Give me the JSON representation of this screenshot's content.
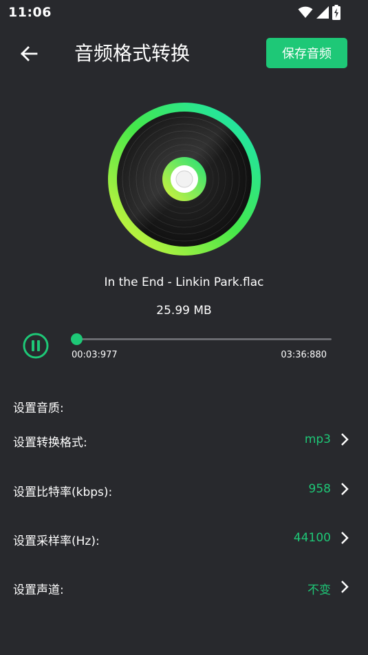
{
  "status_bar": {
    "time": "11:06",
    "icons": [
      "wifi-icon",
      "signal-icon",
      "battery-charging-icon"
    ]
  },
  "header": {
    "back_icon": "arrow-left-icon",
    "title": "音频格式转换",
    "save_label": "保存音频"
  },
  "player": {
    "file_name": "In the End - Linkin Park.flac",
    "file_size": "25.99 MB",
    "state_icon": "pause-icon",
    "current_time": "00:03:977",
    "total_time": "03:36:880",
    "progress": 0.018
  },
  "settings": {
    "section_title": "设置音质:",
    "rows": [
      {
        "label": "设置转换格式:",
        "value": "mp3"
      },
      {
        "label": "设置比特率(kbps):",
        "value": "958"
      },
      {
        "label": "设置采样率(Hz):",
        "value": "44100"
      },
      {
        "label": "设置声道:",
        "value": "不变"
      }
    ]
  },
  "colors": {
    "background": "#28292d",
    "accent": "#1ec877",
    "text": "#ffffff",
    "track": "#6a6b70"
  }
}
